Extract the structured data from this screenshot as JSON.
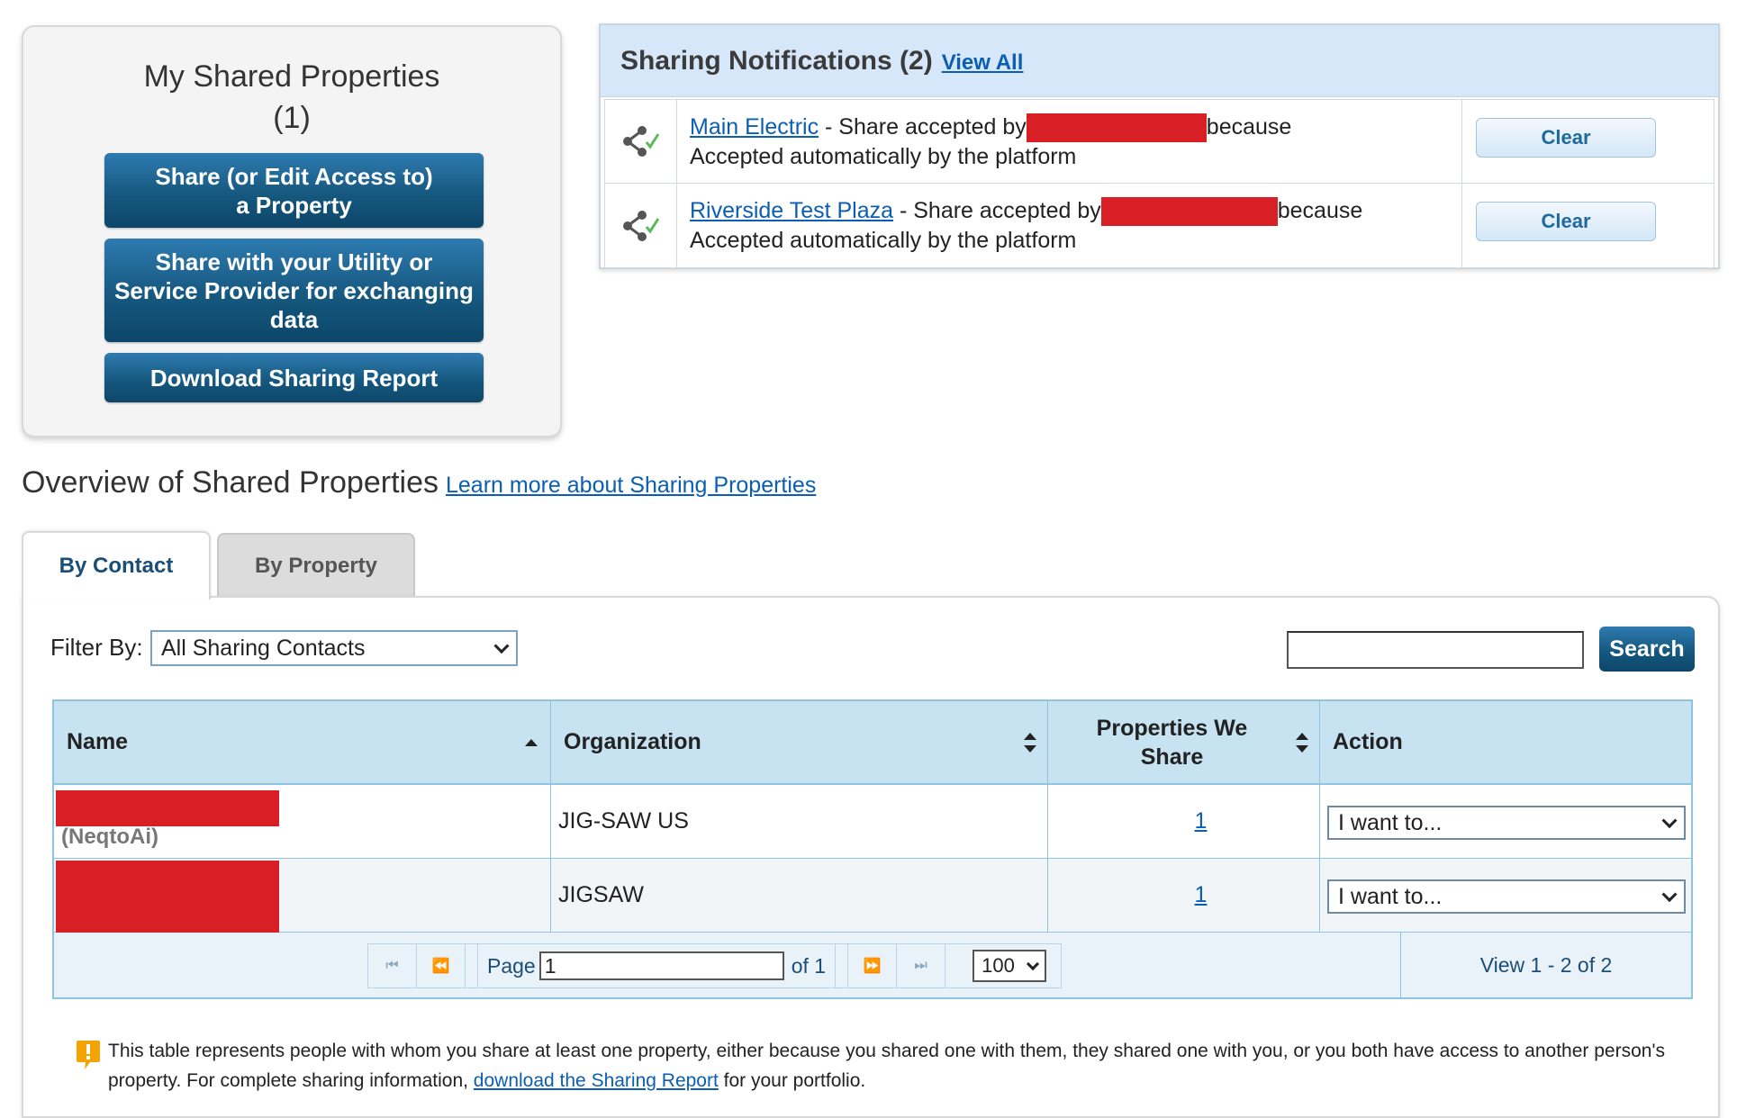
{
  "shared_card": {
    "title_line1": "My Shared Properties",
    "title_line2": "(1)",
    "btn_share_line1": "Share (or Edit Access to)",
    "btn_share_line2": "a Property",
    "btn_utility": "Share with your Utility or Service Provider for exchanging data",
    "btn_report": "Download Sharing Report"
  },
  "notifications": {
    "title": "Sharing Notifications (2)",
    "view_all": "View All",
    "items": [
      {
        "property": "Main Electric",
        "text_before": " - Share accepted by",
        "text_after": "because",
        "reason": "Accepted automatically by the platform",
        "clear": "Clear"
      },
      {
        "property": "Riverside Test Plaza",
        "text_before": " - Share accepted by",
        "text_after": "because",
        "reason": "Accepted automatically by the platform",
        "clear": "Clear"
      }
    ]
  },
  "overview": {
    "title": "Overview of Shared Properties",
    "learn_more": "Learn more about Sharing Properties"
  },
  "tabs": [
    {
      "label": "By Contact",
      "active": true
    },
    {
      "label": "By Property",
      "active": false
    }
  ],
  "filter": {
    "label": "Filter By:",
    "selected": "All Sharing Contacts"
  },
  "search": {
    "value": "",
    "button": "Search"
  },
  "table": {
    "columns": [
      "Name",
      "Organization",
      "Properties We Share",
      "Action"
    ],
    "rows": [
      {
        "name_sub": "(NeqtoAi)",
        "organization": "JIG-SAW US",
        "properties": "1",
        "action": "I want to..."
      },
      {
        "name_sub": "",
        "organization": "JIGSAW",
        "properties": "1",
        "action": "I want to..."
      }
    ]
  },
  "pager": {
    "page_label": "Page",
    "page_value": "1",
    "of_label": "of 1",
    "page_size": "100",
    "view_text": "View 1 - 2 of 2"
  },
  "note": {
    "text_before": "This table represents people with whom you share at least one property, either because you shared one with them, they shared one with you, or you both have access to another person's property. For complete sharing information, ",
    "link": "download the Sharing Report",
    "text_after": " for your portfolio."
  },
  "colors": {
    "primary_button": "#16587f",
    "header_bg": "#c7e3f2",
    "notification_bg": "#d6e7fa",
    "redaction": "#d81f26",
    "link": "#0b5fb3"
  },
  "icons": {
    "notification": "share-accepted-icon",
    "sort": "sort-icon",
    "note": "info-alert-icon"
  }
}
